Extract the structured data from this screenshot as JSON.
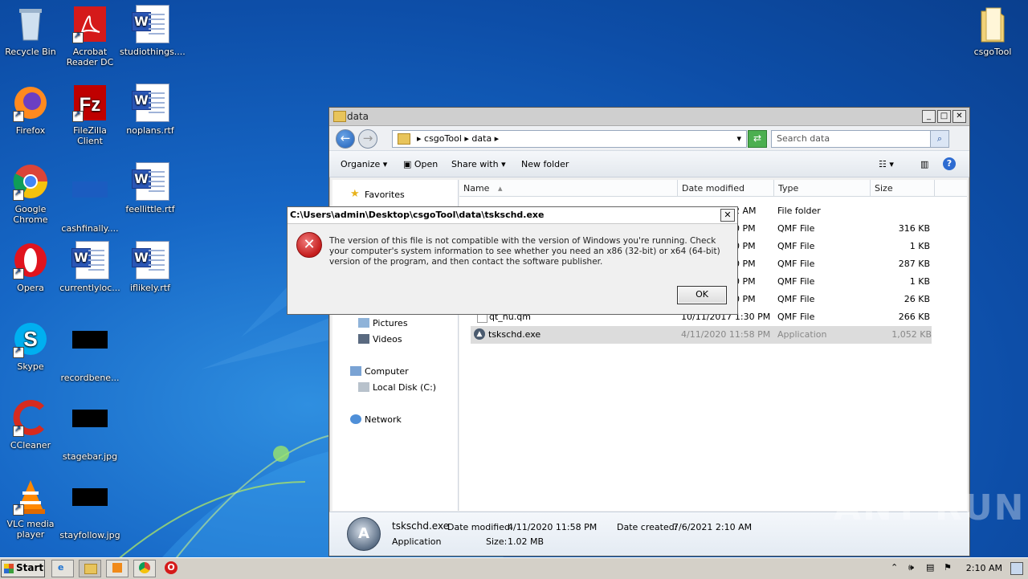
{
  "desktop": {
    "icons": [
      {
        "label": "Recycle Bin"
      },
      {
        "label": "Acrobat Reader DC"
      },
      {
        "label": "studiothings...."
      },
      {
        "label": "Firefox"
      },
      {
        "label": "FileZilla Client"
      },
      {
        "label": "noplans.rtf"
      },
      {
        "label": "Google Chrome"
      },
      {
        "label": "cashfinally...."
      },
      {
        "label": "feellittle.rtf"
      },
      {
        "label": "Opera"
      },
      {
        "label": "currentlyloc..."
      },
      {
        "label": "iflikely.rtf"
      },
      {
        "label": "Skype"
      },
      {
        "label": "recordbene..."
      },
      {
        "label": "CCleaner"
      },
      {
        "label": "stagebar.jpg"
      },
      {
        "label": "VLC media player"
      },
      {
        "label": "stayfollow.jpg"
      },
      {
        "label": "csgoTool"
      }
    ]
  },
  "explorer": {
    "title": "data",
    "address": {
      "crumb1": "csgoTool",
      "crumb2": "data"
    },
    "search_placeholder": "Search data",
    "toolbar": {
      "organize": "Organize",
      "open": "Open",
      "share_with": "Share with",
      "new_folder": "New folder"
    },
    "nav": {
      "favorites": "Favorites",
      "pictures": "Pictures",
      "videos": "Videos",
      "computer": "Computer",
      "local_disk": "Local Disk (C:)",
      "network": "Network"
    },
    "columns": {
      "name": "Name",
      "date_modified": "Date modified",
      "type": "Type",
      "size": "Size"
    },
    "rows": [
      {
        "name": "",
        "date": "52 AM",
        "type": "File folder",
        "size": ""
      },
      {
        "name": "",
        "date": "30 PM",
        "type": "QMF File",
        "size": "316 KB"
      },
      {
        "name": "",
        "date": "30 PM",
        "type": "QMF File",
        "size": "1 KB"
      },
      {
        "name": "",
        "date": "30 PM",
        "type": "QMF File",
        "size": "287 KB"
      },
      {
        "name": "",
        "date": "30 PM",
        "type": "QMF File",
        "size": "1 KB"
      },
      {
        "name": "",
        "date": "30 PM",
        "type": "QMF File",
        "size": "26 KB"
      },
      {
        "name": "qt_hu.qm",
        "date": "10/11/2017 1:30 PM",
        "type": "QMF File",
        "size": "266 KB"
      },
      {
        "name": "tskschd.exe",
        "date": "4/11/2020 11:58 PM",
        "type": "Application",
        "size": "1,052 KB"
      }
    ],
    "details": {
      "filename": "tskschd.exe",
      "filetype": "Application",
      "date_modified_label": "Date modified:",
      "date_modified": "4/11/2020 11:58 PM",
      "size_label": "Size:",
      "size": "1.02 MB",
      "date_created_label": "Date created:",
      "date_created": "7/6/2021 2:10 AM"
    }
  },
  "dialog": {
    "title": "C:\\Users\\admin\\Desktop\\csgoTool\\data\\tskschd.exe",
    "message": "The version of this file is not compatible with the version of Windows you're running. Check your computer's system information to see whether you need an x86 (32-bit) or x64 (64-bit) version of the program, and then contact the software publisher.",
    "ok": "OK"
  },
  "taskbar": {
    "start": "Start",
    "clock": "2:10 AM"
  },
  "watermark": "ANY RUN"
}
